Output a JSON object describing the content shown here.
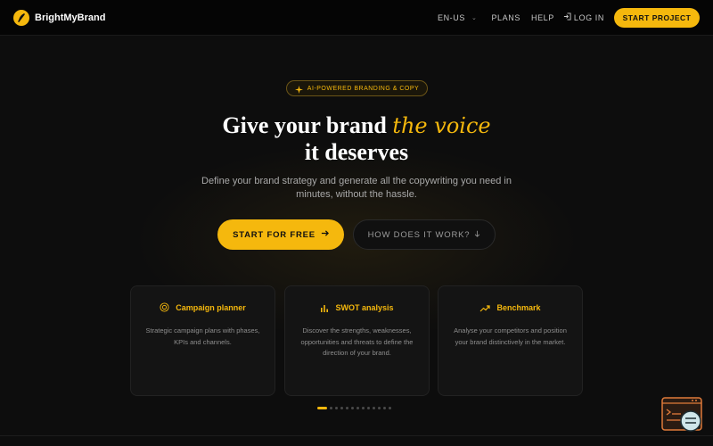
{
  "nav": {
    "brand": "BrightMyBrand",
    "language": "EN-US",
    "plans": "PLANS",
    "help": "HELP",
    "login": "LOG IN",
    "cta": "START PROJECT"
  },
  "hero": {
    "tag": "AI-POWERED BRANDING & COPY",
    "headline_part1": "Give your brand ",
    "headline_accent": "the voice",
    "headline_line2": "it deserves",
    "subtitle": "Define your brand strategy and generate all the copywriting you need in minutes, without the hassle.",
    "primary_cta": "START FOR FREE",
    "secondary_cta": "HOW DOES IT WORK?"
  },
  "features": [
    {
      "title": "Campaign planner",
      "icon": "target-icon",
      "description": "Strategic campaign plans with phases, KPIs and channels."
    },
    {
      "title": "SWOT analysis",
      "icon": "bar-chart-icon",
      "description": "Discover the strengths, weaknesses, opportunities and threats to define the direction of your brand."
    },
    {
      "title": "Benchmark",
      "icon": "trend-up-icon",
      "description": "Analyse your competitors and position your brand distinctively in the market."
    }
  ],
  "carousel": {
    "total": 13,
    "active": 1
  },
  "colors": {
    "accent": "#f5b80d",
    "background": "#0d0d0d",
    "nav": "#050505",
    "card": "#141414"
  }
}
